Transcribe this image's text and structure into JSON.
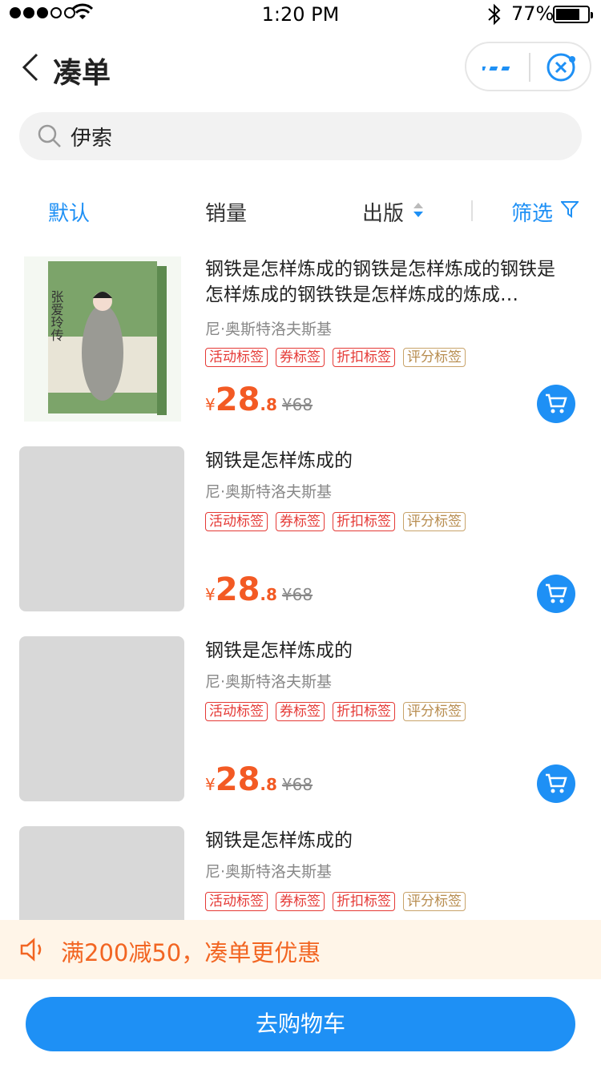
{
  "status_bar": {
    "time": "1:20 PM",
    "battery": "77%",
    "battery_level": 0.77
  },
  "nav": {
    "title": "凑单"
  },
  "search": {
    "value": "伊索"
  },
  "sort": {
    "default": "默认",
    "sales": "销量",
    "publish": "出版",
    "filter": "筛选"
  },
  "products": [
    {
      "title": "钢铁是怎样炼成的钢铁是怎样炼成的钢铁是怎样炼成的钢铁铁是怎样炼成的炼成…",
      "author": "尼·奥斯特洛夫斯基",
      "tags": [
        "活动标签",
        "券标签",
        "折扣标签",
        "评分标签"
      ],
      "currency": "¥",
      "price_int": "28",
      "price_dec": ".8",
      "orig_price": "¥68",
      "cover_title": "张爱玲传"
    },
    {
      "title": "钢铁是怎样炼成的",
      "author": "尼·奥斯特洛夫斯基",
      "tags": [
        "活动标签",
        "券标签",
        "折扣标签",
        "评分标签"
      ],
      "currency": "¥",
      "price_int": "28",
      "price_dec": ".8",
      "orig_price": "¥68"
    },
    {
      "title": "钢铁是怎样炼成的",
      "author": "尼·奥斯特洛夫斯基",
      "tags": [
        "活动标签",
        "券标签",
        "折扣标签",
        "评分标签"
      ],
      "currency": "¥",
      "price_int": "28",
      "price_dec": ".8",
      "orig_price": "¥68"
    },
    {
      "title": "钢铁是怎样炼成的",
      "author": "尼·奥斯特洛夫斯基",
      "tags": [
        "活动标签",
        "券标签",
        "折扣标签",
        "评分标签"
      ]
    }
  ],
  "promo": {
    "text": "满200减50，凑单更优惠"
  },
  "bottom": {
    "go_cart": "去购物车"
  },
  "colors": {
    "accent": "#1e90f5",
    "price": "#f35a24",
    "promo_text": "#f26522",
    "tag_red": "#e53935",
    "tag_gold": "#c8a36a"
  }
}
